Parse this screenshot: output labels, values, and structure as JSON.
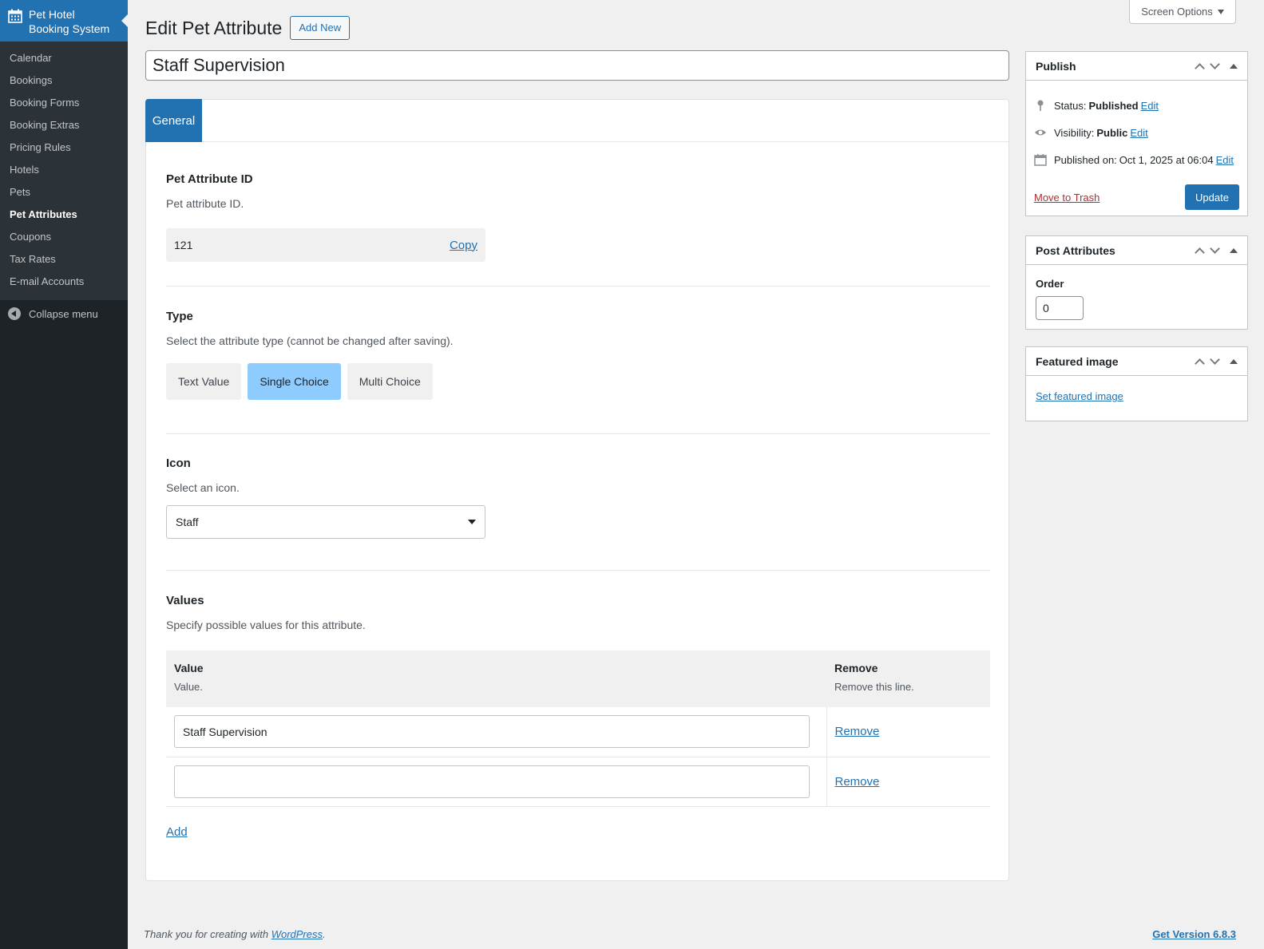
{
  "sidebar": {
    "plugin_title": "Pet Hotel Booking System",
    "items": [
      "Calendar",
      "Bookings",
      "Booking Forms",
      "Booking Extras",
      "Pricing Rules",
      "Hotels",
      "Pets",
      "Pet Attributes",
      "Coupons",
      "Tax Rates",
      "E-mail Accounts"
    ],
    "current": "Pet Attributes",
    "collapse_label": "Collapse menu"
  },
  "screen_options": "Screen Options",
  "header": {
    "title": "Edit Pet Attribute",
    "add_new": "Add New"
  },
  "post_title": "Staff Supervision",
  "tabs": {
    "general": "General"
  },
  "sections": {
    "id": {
      "title": "Pet Attribute ID",
      "desc": "Pet attribute ID.",
      "value": "121",
      "copy": "Copy"
    },
    "type": {
      "title": "Type",
      "desc": "Select the attribute type (cannot be changed after saving).",
      "options": [
        "Text Value",
        "Single Choice",
        "Multi Choice"
      ],
      "selected": "Single Choice"
    },
    "icon": {
      "title": "Icon",
      "desc": "Select an icon.",
      "selected": "Staff"
    },
    "values": {
      "title": "Values",
      "desc": "Specify possible values for this attribute.",
      "col_value": "Value",
      "col_value_sub": "Value.",
      "col_remove": "Remove",
      "col_remove_sub": "Remove this line.",
      "rows": [
        "Staff Supervision",
        ""
      ],
      "remove_label": "Remove",
      "add_label": "Add"
    }
  },
  "publish": {
    "title": "Publish",
    "status_label": "Status:",
    "status_value": "Published",
    "visibility_label": "Visibility:",
    "visibility_value": "Public",
    "published_label": "Published on:",
    "published_value": "Oct 1, 2025 at 06:04",
    "edit": "Edit",
    "trash": "Move to Trash",
    "update": "Update"
  },
  "post_attributes": {
    "title": "Post Attributes",
    "order_label": "Order",
    "order_value": "0"
  },
  "featured_image": {
    "title": "Featured image",
    "set_link": "Set featured image"
  },
  "footer": {
    "thanks": "Thank you for creating with",
    "wp_link": "WordPress",
    "version": "Get Version 6.8.3"
  },
  "colors": {
    "accent": "#2271b1",
    "sidebar_bg": "#1d2327",
    "selected_type": "#8ecbff",
    "trash": "#b32d2e"
  }
}
